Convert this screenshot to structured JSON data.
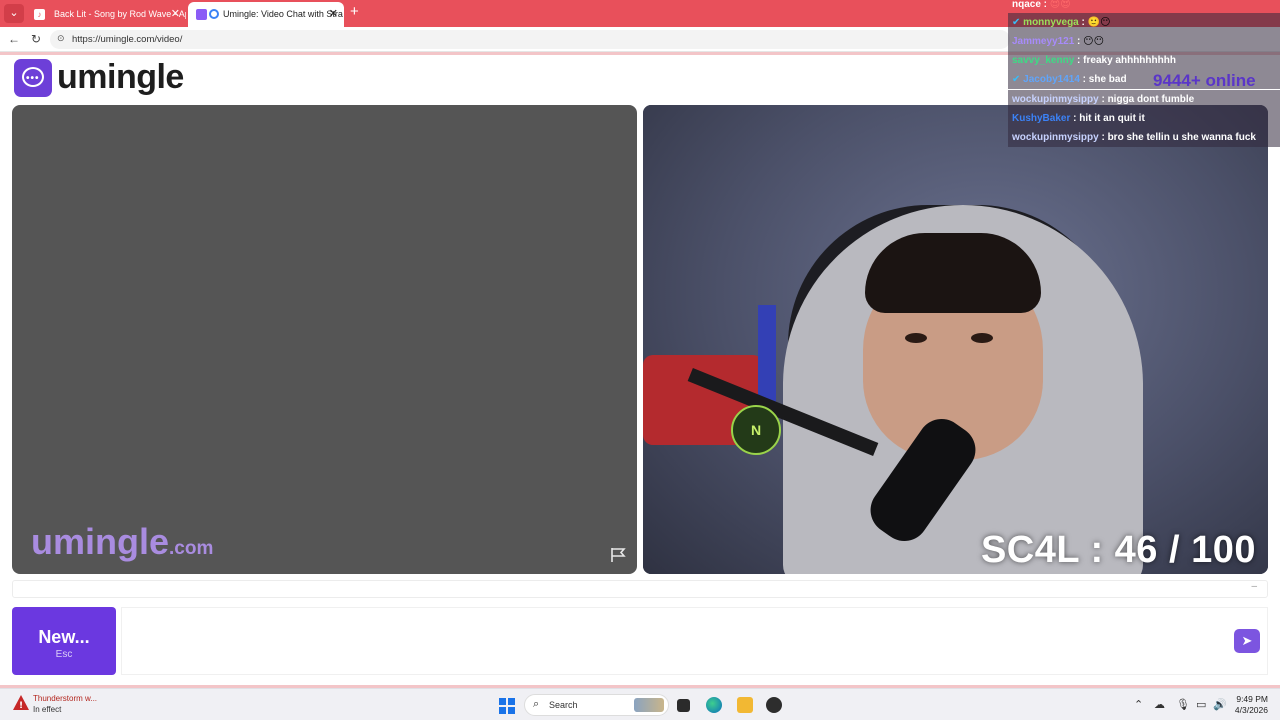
{
  "browser": {
    "tabs": [
      {
        "title": "Back Lit - Song by Rod Wave - Ap",
        "active": false
      },
      {
        "title": "Umingle: Video Chat with Stra",
        "active": true
      }
    ],
    "url": "https://umingle.com/video/"
  },
  "site": {
    "brand": "umingle"
  },
  "left_pane": {
    "watermark_main": "umingle",
    "watermark_suffix": ".com"
  },
  "right_pane": {
    "mic_badge": "N",
    "score_overlay": "SC4L : 46 / 100"
  },
  "stream_chat": {
    "online_count": "9444+",
    "online_label": "online",
    "messages": [
      {
        "user": "nqace",
        "text": "",
        "color": "#ffffff"
      },
      {
        "user": "monnyvega",
        "text": "",
        "color": "#9be05a"
      },
      {
        "user": "Jammeyy121",
        "text": "",
        "color": "#a78bfa"
      },
      {
        "user": "savvy_kenny",
        "text": "freaky ahhhhhhhhh",
        "color": "#3ddc84"
      },
      {
        "user": "Jacoby1414",
        "text": "she bad",
        "color": "#60a5fa"
      },
      {
        "user": "wockupinmysippy",
        "text": "nigga dont fumble",
        "color": "#c7d2fe"
      },
      {
        "user": "KushyBaker",
        "text": "hit it an quit it",
        "color": "#3b82f6"
      },
      {
        "user": "wockupinmysippy",
        "text": "bro she tellin u she wanna fuck",
        "color": "#c7d2fe"
      }
    ]
  },
  "controls": {
    "new_label": "New...",
    "new_shortcut": "Esc",
    "message_placeholder": ""
  },
  "taskbar": {
    "weather_title": "Thunderstorm w...",
    "weather_status": "In effect",
    "search_label": "Search",
    "time": "9:49 PM",
    "date": "4/3/2026"
  }
}
